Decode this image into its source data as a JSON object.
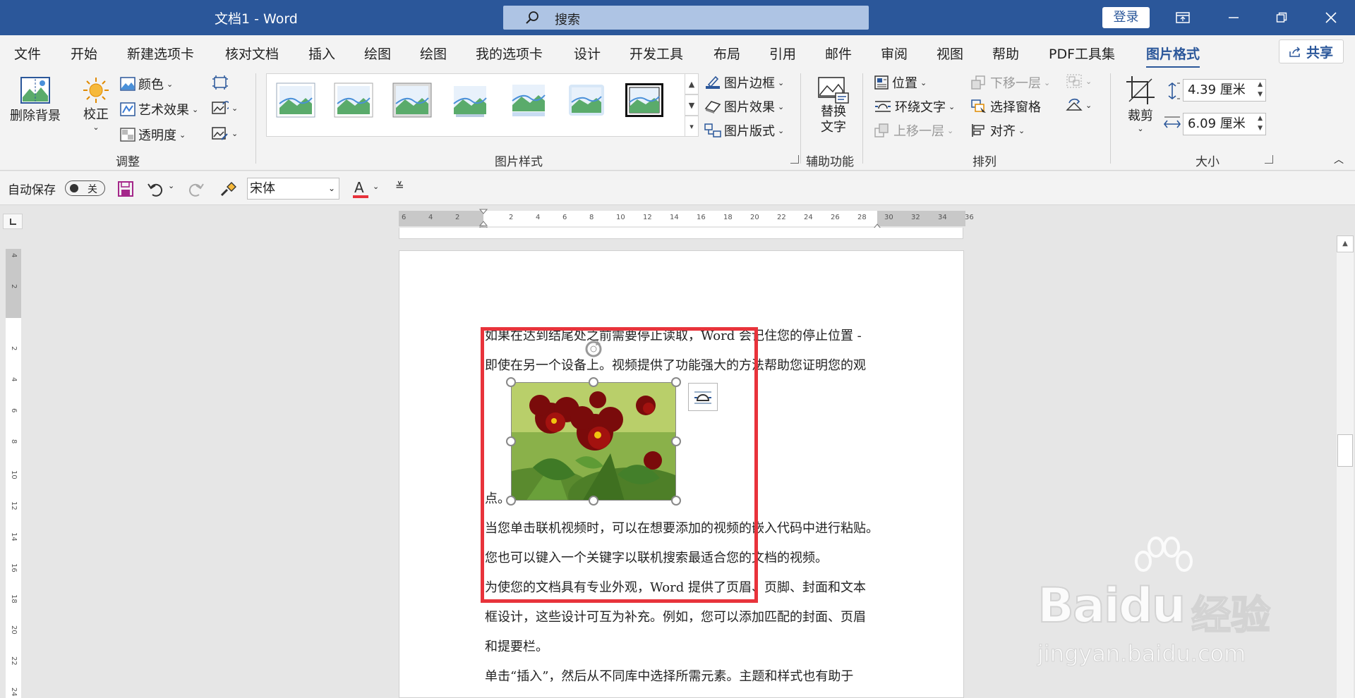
{
  "titlebar": {
    "title": "文档1  -  Word",
    "search_placeholder": "搜索",
    "login_label": "登录"
  },
  "menu": {
    "tabs": [
      "文件",
      "开始",
      "新建选项卡",
      "核对文档",
      "插入",
      "绘图",
      "绘图",
      "我的选项卡",
      "设计",
      "开发工具",
      "布局",
      "引用",
      "邮件",
      "审阅",
      "视图",
      "帮助",
      "PDF工具集",
      "图片格式"
    ],
    "active_tab": "图片格式",
    "share_label": "共享"
  },
  "ribbon": {
    "adjust": {
      "remove_bg": "删除背景",
      "correct": "校正",
      "color": "颜色",
      "art_effects": "艺术效果",
      "transparency": "透明度",
      "group_label": "调整"
    },
    "styles": {
      "border": "图片边框",
      "effects": "图片效果",
      "layout": "图片版式",
      "group_label": "图片样式"
    },
    "accessibility": {
      "alt_text_line1": "替换",
      "alt_text_line2": "文字",
      "group_label": "辅助功能"
    },
    "arrange": {
      "position": "位置",
      "wrap_text": "环绕文字",
      "bring_forward": "上移一层",
      "send_backward": "下移一层",
      "selection_pane": "选择窗格",
      "align": "对齐",
      "group_label": "排列"
    },
    "size": {
      "crop": "裁剪",
      "height": "4.39 厘米",
      "width": "6.09 厘米",
      "group_label": "大小"
    }
  },
  "qat": {
    "autosave_label": "自动保存",
    "autosave_state": "关",
    "font_name": "宋体"
  },
  "ruler": {
    "h_labels": [
      "6",
      "4",
      "2",
      "",
      "2",
      "4",
      "6",
      "8",
      "10",
      "12",
      "14",
      "16",
      "18",
      "20",
      "22",
      "24",
      "26",
      "28",
      "30",
      "32",
      "34",
      "36"
    ],
    "v_labels": [
      "4",
      "2",
      "",
      "2",
      "4",
      "6",
      "8",
      "10",
      "12",
      "14",
      "16",
      "18",
      "20",
      "22",
      "24"
    ]
  },
  "document": {
    "lines": [
      "如果在达到结尾处之前需要停止读取，Word 会记住您的停止位置 -",
      "即使在另一个设备上。视频提供了功能强大的方法帮助您证明您的观",
      "点。",
      "当您单击联机视频时，可以在想要添加的视频的嵌入代码中进行粘贴。",
      "您也可以键入一个关键字以联机搜索最适合您的文档的视频。",
      "为使您的文档具有专业外观，Word 提供了页眉、页脚、封面和文本",
      "框设计，这些设计可互为补充。例如，您可以添加匹配的封面、页眉",
      "和提要栏。",
      "单击“插入”，然后从不同库中选择所需元素。主题和样式也有助于"
    ]
  },
  "watermark": {
    "brand": "Bai",
    "brand2": "du",
    "cn": "经验",
    "url": "jingyan.baidu.com"
  },
  "colors": {
    "word_blue": "#2b579a",
    "highlight_red": "#e8333b"
  }
}
